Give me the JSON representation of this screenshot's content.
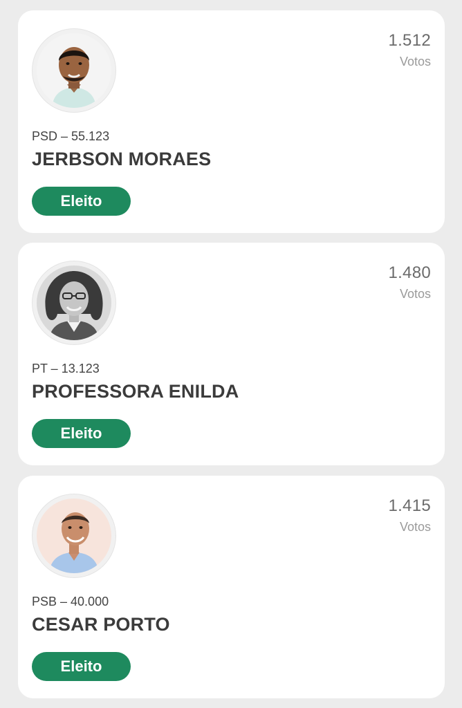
{
  "candidates": [
    {
      "party": "PSD – 55.123",
      "name": "JERBSON MORAES",
      "votes": "1.512",
      "votes_label": "Votos",
      "status": "Eleito",
      "photo": "candidate-photo-man-dark-hair"
    },
    {
      "party": "PT – 13.123",
      "name": "PROFESSORA ENILDA",
      "votes": "1.480",
      "votes_label": "Votos",
      "status": "Eleito",
      "photo": "candidate-photo-woman-curly-hair-glasses-grayscale"
    },
    {
      "party": "PSB – 40.000",
      "name": "CESAR PORTO",
      "votes": "1.415",
      "votes_label": "Votos",
      "status": "Eleito",
      "photo": "candidate-photo-man-bald-blue-shirt"
    }
  ],
  "colors": {
    "background": "#ececec",
    "card": "#ffffff",
    "status_badge": "#1e8a5e",
    "name_text": "#3b3b3b",
    "votes_text": "#6b6b6b",
    "votes_label_text": "#9a9a9a"
  }
}
